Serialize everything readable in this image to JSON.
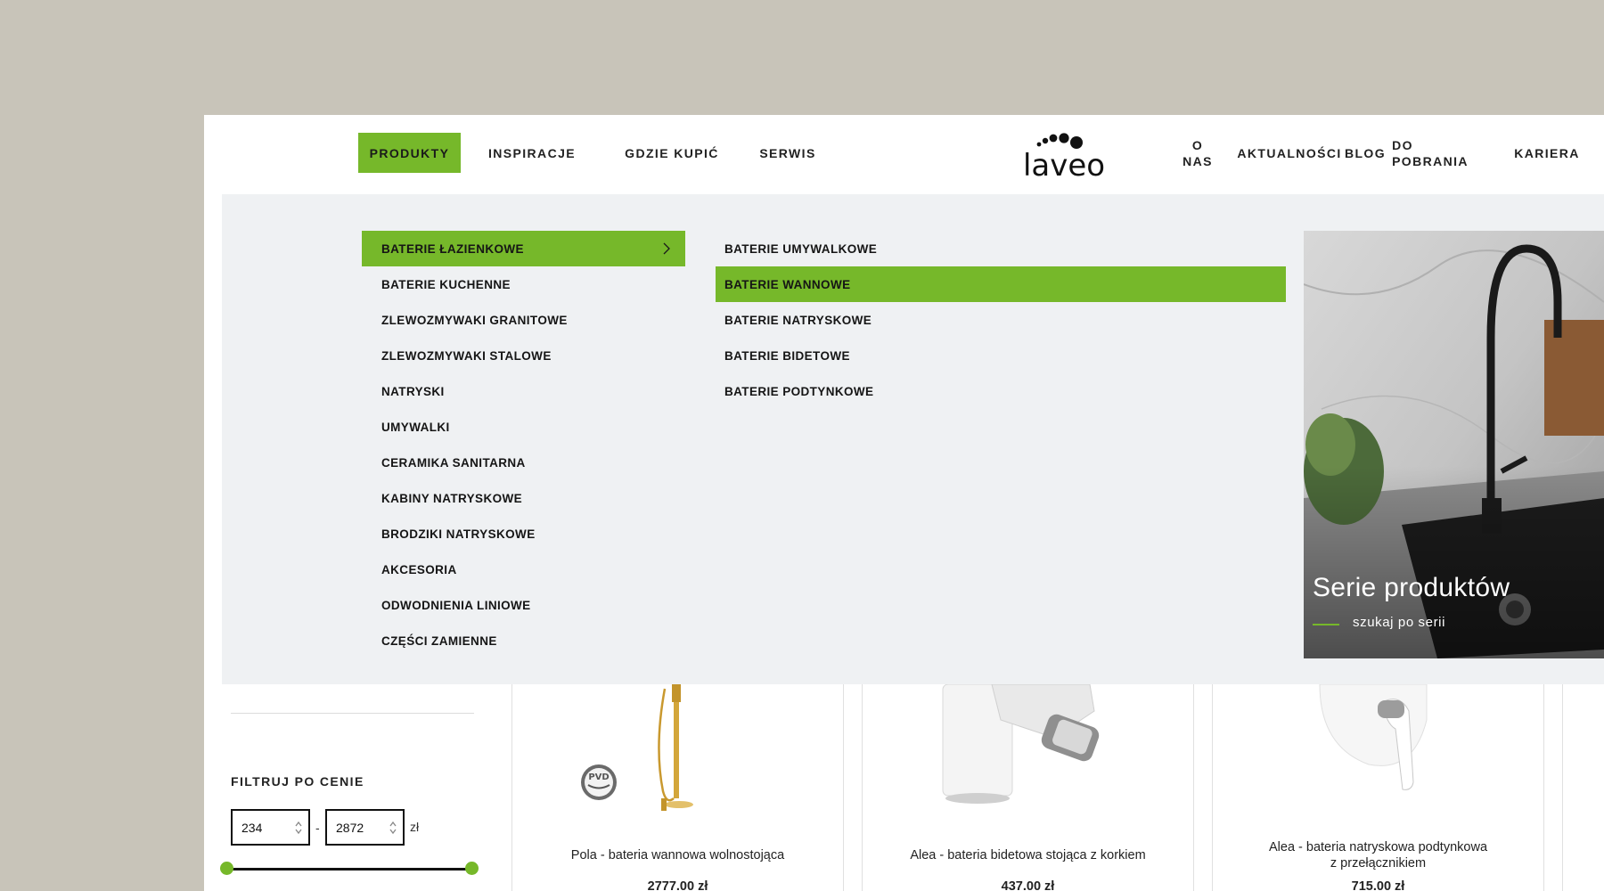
{
  "nav": {
    "left": [
      "PRODUKTY",
      "INSPIRACJE",
      "GDZIE KUPIĆ",
      "SERWIS"
    ],
    "right": [
      {
        "line1": "O",
        "line2": "NAS"
      },
      {
        "line1": "AKTUALNOŚCI",
        "line2": ""
      },
      {
        "line1": "BLOG",
        "line2": ""
      },
      {
        "line1": "DO",
        "line2": "POBRANIA"
      },
      {
        "line1": "KARIERA",
        "line2": ""
      }
    ],
    "logo_text": "laveo"
  },
  "mega_menu": {
    "categories": [
      "BATERIE ŁAZIENKOWE",
      "BATERIE KUCHENNE",
      "ZLEWOZMYWAKI GRANITOWE",
      "ZLEWOZMYWAKI STALOWE",
      "NATRYSKI",
      "UMYWALKI",
      "CERAMIKA SANITARNA",
      "KABINY NATRYSKOWE",
      "BRODZIKI NATRYSKOWE",
      "AKCESORIA",
      "ODWODNIENIA LINIOWE",
      "CZĘŚCI ZAMIENNE"
    ],
    "active_category": "BATERIE ŁAZIENKOWE",
    "subcategories": [
      "BATERIE UMYWALKOWE",
      "BATERIE WANNOWE",
      "BATERIE NATRYSKOWE",
      "BATERIE BIDETOWE",
      "BATERIE PODTYNKOWE"
    ],
    "active_subcategory": "BATERIE WANNOWE",
    "promo": {
      "title": "Serie produktów",
      "subtitle": "szukaj po serii"
    }
  },
  "filter": {
    "title": "FILTRUJ PO CENIE",
    "min": "234",
    "max": "2872",
    "currency": "zł",
    "separator": "-"
  },
  "products": [
    {
      "name": "Pola - bateria wannowa wolnostojąca",
      "price": "2777.00 zł",
      "badge": "PVD"
    },
    {
      "name": "Alea - bateria bidetowa stojąca z korkiem",
      "price": "437.00 zł"
    },
    {
      "name_line1": "Alea - bateria natryskowa podtynkowa",
      "name_line2": "z przełącznikiem",
      "price": "715.00 zł"
    }
  ],
  "colors": {
    "accent": "#76b82a",
    "background": "#c8c4b9",
    "menu_bg": "#eff1f3"
  }
}
